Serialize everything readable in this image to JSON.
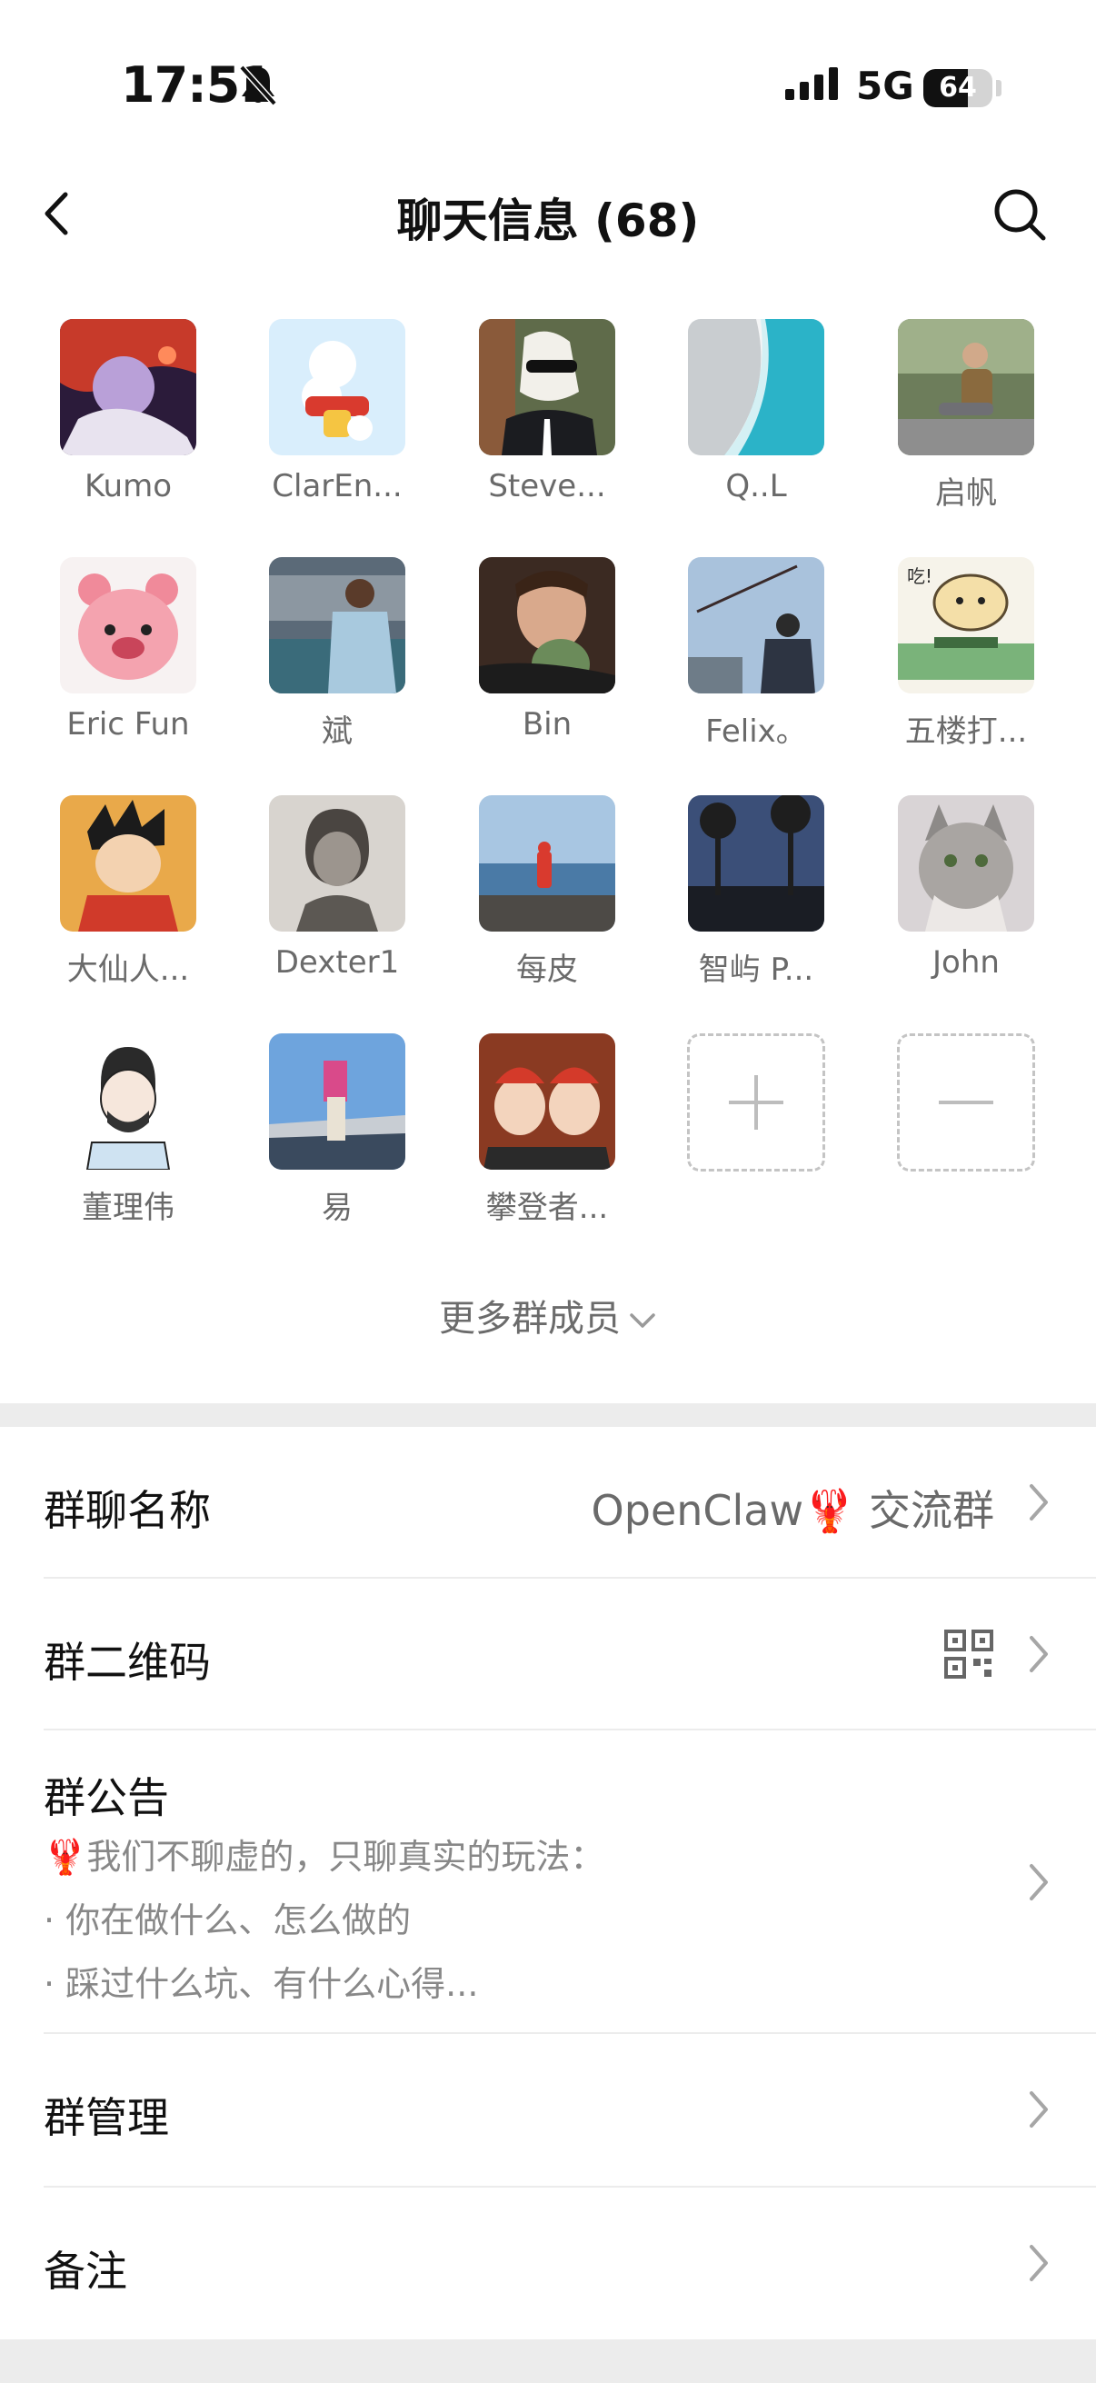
{
  "status_bar": {
    "time": "17:51",
    "network": "5G",
    "battery_level": "64"
  },
  "nav": {
    "title": "聊天信息 (68)"
  },
  "members": [
    {
      "name": "Kumo"
    },
    {
      "name": "ClarEn..."
    },
    {
      "name": "Steve..."
    },
    {
      "name": "Q..L"
    },
    {
      "name": "启帆"
    },
    {
      "name": "Eric Fun"
    },
    {
      "name": "斌"
    },
    {
      "name": "Bin"
    },
    {
      "name": "Felix。"
    },
    {
      "name": "五楼打..."
    },
    {
      "name": "大仙人..."
    },
    {
      "name": "Dexter1"
    },
    {
      "name": "每皮"
    },
    {
      "name": "智屿 P..."
    },
    {
      "name": "John"
    },
    {
      "name": "董理伟"
    },
    {
      "name": "易"
    },
    {
      "name": "攀登者..."
    }
  ],
  "more_members": "更多群成员",
  "settings": {
    "group_name": {
      "label": "群聊名称",
      "value": "OpenClaw🦞 交流群"
    },
    "qr_code": {
      "label": "群二维码"
    },
    "announcement": {
      "label": "群公告",
      "lines": [
        "🦞我们不聊虚的，只聊真实的玩法：",
        "· 你在做什么、怎么做的",
        "· 踩过什么坑、有什么心得..."
      ]
    },
    "manage": {
      "label": "群管理"
    },
    "remark": {
      "label": "备注"
    }
  }
}
